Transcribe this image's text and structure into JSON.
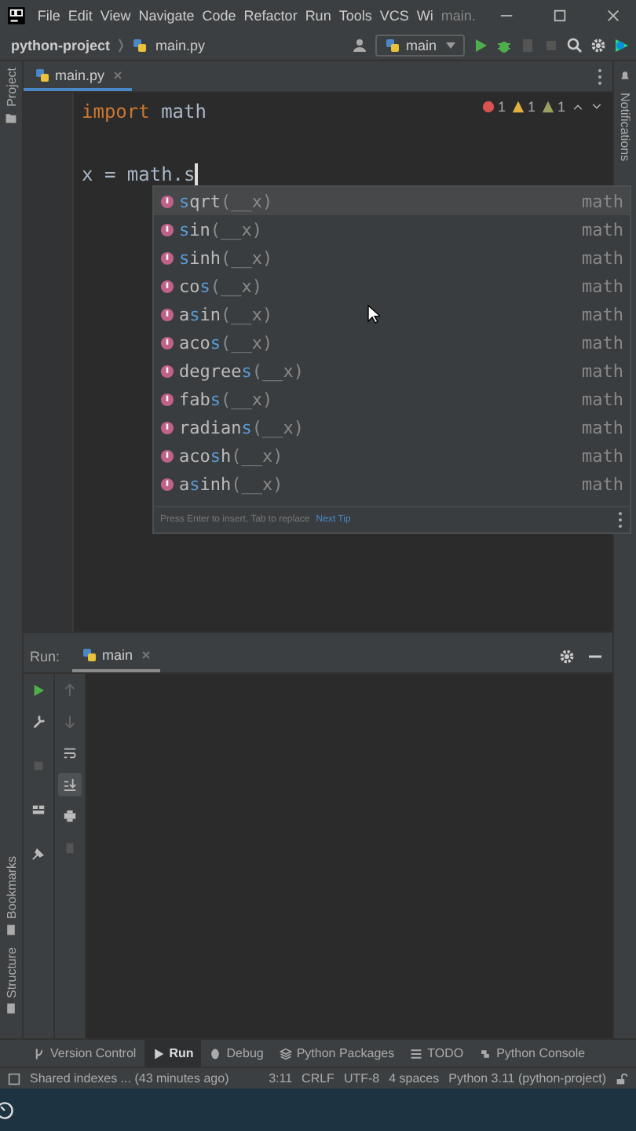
{
  "window": {
    "title": "main.",
    "menu": [
      "File",
      "Edit",
      "View",
      "Navigate",
      "Code",
      "Refactor",
      "Run",
      "Tools",
      "VCS",
      "Wi"
    ]
  },
  "nav": {
    "project": "python-project",
    "file": "main.py",
    "run_config": "main"
  },
  "editor_tabs": [
    {
      "label": "main.py",
      "selected": true
    }
  ],
  "side_tools": {
    "left_top": "Project",
    "left_bottom": [
      "Bookmarks",
      "Structure"
    ],
    "right": "Notifications"
  },
  "inspections": [
    {
      "kind": "error",
      "count": "1"
    },
    {
      "kind": "warning",
      "count": "1"
    },
    {
      "kind": "weak",
      "count": "1"
    }
  ],
  "code_lines": [
    {
      "keyword": "import",
      "text": " math"
    },
    {
      "text": "x = math.s",
      "caret": true
    }
  ],
  "completion": {
    "items": [
      {
        "match": "s",
        "after": "qrt",
        "args": "(__x)",
        "module": "math",
        "selected": true
      },
      {
        "match": "s",
        "after": "in",
        "args": "(__x)",
        "module": "math",
        "selected": false
      },
      {
        "match": "s",
        "after": "inh",
        "args": "(__x)",
        "module": "math",
        "selected": false
      },
      {
        "before": "co",
        "match": "s",
        "args": "(__x)",
        "module": "math",
        "selected": false
      },
      {
        "before": "a",
        "match": "s",
        "after": "in",
        "args": "(__x)",
        "module": "math",
        "selected": false
      },
      {
        "before": "aco",
        "match": "s",
        "args": "(__x)",
        "module": "math",
        "selected": false
      },
      {
        "before": "degree",
        "match": "s",
        "args": "(__x)",
        "module": "math",
        "selected": false
      },
      {
        "before": "fab",
        "match": "s",
        "args": "(__x)",
        "module": "math",
        "selected": false
      },
      {
        "before": "radian",
        "match": "s",
        "args": "(__x)",
        "module": "math",
        "selected": false
      },
      {
        "before": "aco",
        "match": "s",
        "after": "h",
        "args": "(__x)",
        "module": "math",
        "selected": false
      },
      {
        "before": "a",
        "match": "s",
        "after": "inh",
        "args": "(__x)",
        "module": "math",
        "selected": false
      }
    ],
    "hint": "Press Enter to insert, Tab to replace",
    "link": "Next Tip"
  },
  "run_panel": {
    "label": "Run:",
    "tabs": [
      {
        "label": "main",
        "selected": true
      }
    ]
  },
  "bottom_tabs": [
    {
      "label": "Version Control",
      "selected": false
    },
    {
      "label": "Run",
      "selected": true
    },
    {
      "label": "Debug",
      "selected": false
    },
    {
      "label": "Python Packages",
      "selected": false
    },
    {
      "label": "TODO",
      "selected": false
    },
    {
      "label": "Python Console",
      "selected": false
    }
  ],
  "status_bar": {
    "message": "Shared indexes ... (43 minutes ago)",
    "items": [
      "3:11",
      "CRLF",
      "UTF-8",
      "4 spaces",
      "Python 3.11 (python-project)"
    ]
  }
}
